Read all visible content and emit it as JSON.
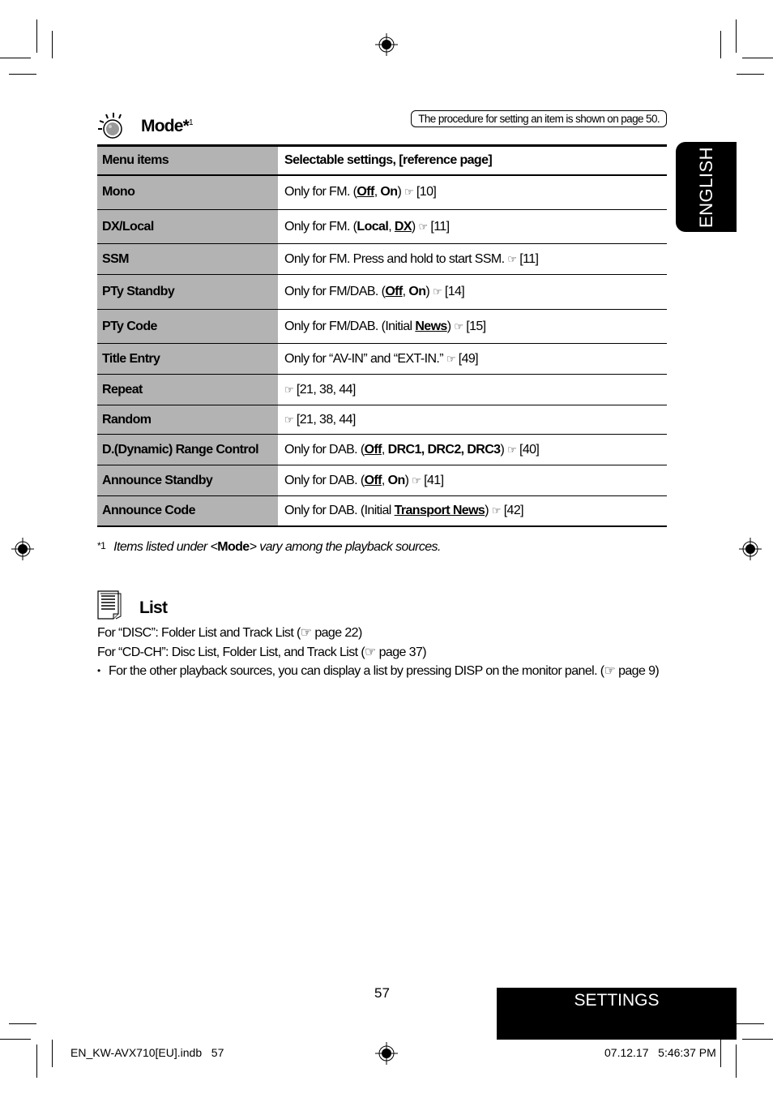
{
  "mode_section": {
    "title": "Mode*",
    "title_footnote_ref": "1",
    "procedure_note": "The procedure for setting an item is shown on page 50.",
    "icon": "knob-icon"
  },
  "table": {
    "headers": [
      "Menu items",
      "Selectable settings, [reference page]"
    ],
    "rows": [
      {
        "item": "Mono",
        "setting_html": "Only for FM. (<b><u>Off</u></b>, <b>On</b>) <span class='hand'>☞</span> [10]"
      },
      {
        "item": "DX/Local",
        "setting_html": "Only for FM. (<b>Local</b>, <b><u>DX</u></b>) <span class='hand'>☞</span> [11]"
      },
      {
        "item": "SSM",
        "setting_html": "Only for FM. Press and hold to start SSM. <span class='hand'>☞</span> [11]"
      },
      {
        "item": "PTy Standby",
        "setting_html": "Only for FM/DAB. (<b><u>Off</u></b>, <b>On</b>) <span class='hand'>☞</span> [14]"
      },
      {
        "item": "PTy Code",
        "setting_html": "Only for FM/DAB. (Initial <b><u>News</u></b>) <span class='hand'>☞</span> [15]"
      },
      {
        "item": "Title Entry",
        "setting_html": "Only for “AV-IN” and “EXT-IN.” <span class='hand'>☞</span> [49]"
      },
      {
        "item": "Repeat",
        "setting_html": "<span class='hand'>☞</span> [21, 38, 44]"
      },
      {
        "item": "Random",
        "setting_html": "<span class='hand'>☞</span> [21, 38, 44]"
      },
      {
        "item": "D.(Dynamic) Range Control",
        "setting_html": "Only for DAB. (<b><u>Off</u></b>, <b>DRC1, DRC2, DRC3</b>) <span class='hand'>☞</span> [40]"
      },
      {
        "item": "Announce Standby",
        "setting_html": "Only for DAB. (<b><u>Off</u></b>, <b>On</b>) <span class='hand'>☞</span> [41]"
      },
      {
        "item": "Announce Code",
        "setting_html": "Only for DAB. (Initial <b><u>Transport News</u></b>) <span class='hand'>☞</span> [42]"
      }
    ]
  },
  "footnote": {
    "mark": "*1",
    "text_before": "Items listed under <",
    "text_bold": "Mode",
    "text_after": "> vary among the playback sources."
  },
  "list_section": {
    "title": "List",
    "icon": "document-list-icon",
    "lines": [
      "For “DISC”: Folder List and Track List (☞ page 22)",
      "For “CD-CH”: Disc List, Folder List, and Track List (☞ page 37)"
    ],
    "bullet": "For the other playback sources, you can display a list by pressing DISP on the monitor panel. (☞ page 9)"
  },
  "side_tab": "ENGLISH",
  "page_number": "57",
  "section_tab": "SETTINGS",
  "slug": {
    "file": "EN_KW-AVX710[EU].indb   57",
    "timestamp": "07.12.17   5:46:37 PM"
  }
}
